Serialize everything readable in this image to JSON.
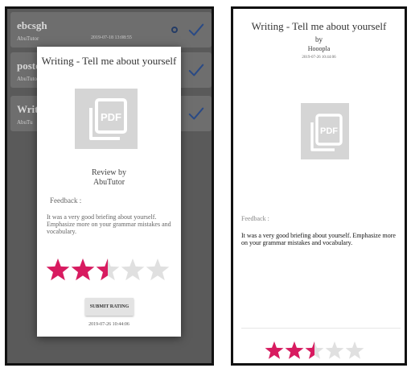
{
  "left_screen": {
    "list": [
      {
        "title": "ebcsgh",
        "author": "AbuTutor",
        "date": "2019-07-18 13:08:55"
      },
      {
        "title": "poste",
        "author": "AbuTuto"
      },
      {
        "title": "Writi",
        "author": "AbuTu"
      }
    ],
    "icons": {
      "status": "ring-icon",
      "done": "check-icon"
    },
    "modal": {
      "title": "Writing - Tell me about yourself",
      "pdf_label": "PDF",
      "review_by": "Review by",
      "reviewer": "AbuTutor",
      "feedback_label": "Feedback :",
      "feedback_text": "It was a very good briefing about yourself. Emphasize more on your grammar mistakes and vocabulary.",
      "rating": 2.5,
      "rating_max": 5,
      "submit_label": "SUBMIT RATING",
      "date": "2019-07-26 10:44:06"
    }
  },
  "right_screen": {
    "title": "Writing - Tell me about yourself",
    "by": "by",
    "author": "Hooopla",
    "date": "2019-07-26 10:44:06",
    "pdf_label": "PDF",
    "feedback_label": "Feedback :",
    "feedback_text": "It was a very good briefing about yourself. Emphasize more on your grammar mistakes and vocabulary.",
    "rating": 2.5,
    "rating_max": 5
  },
  "colors": {
    "star_filled": "#d81b60",
    "star_empty": "#e0e0e0",
    "check": "#2a4a85",
    "overlay": "#5a5a5a"
  }
}
